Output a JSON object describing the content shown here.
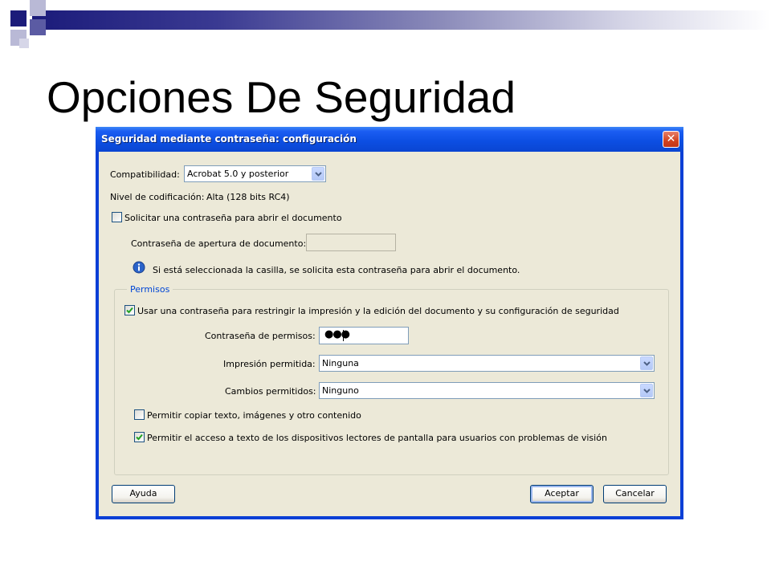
{
  "slide": {
    "title": "Opciones De Seguridad",
    "accent_color": "#1b1b7a"
  },
  "dialog": {
    "title": "Seguridad mediante contraseña: configuración",
    "close_icon": "close-icon",
    "compat": {
      "label": "Compatibilidad:",
      "value": "Acrobat 5.0 y posterior"
    },
    "encryption": {
      "label": "Nivel de codificación:",
      "value": "Alta (128 bits RC4)"
    },
    "open_password": {
      "checkbox_label": "Solicitar una contraseña para abrir el documento",
      "checked": false,
      "field_label": "Contraseña de apertura de documento:",
      "value": "",
      "info_icon": "info-icon",
      "info_text": "Si está seleccionada la casilla, se solicita esta contraseña para abrir el documento."
    },
    "permissions": {
      "legend": "Permisos",
      "restrict_label": "Usar una contraseña para restringir la impresión y la edición del documento y su configuración de seguridad",
      "restrict_checked": true,
      "password_label": "Contraseña de permisos:",
      "password_mask": "●●●",
      "printing_label": "Impresión permitida:",
      "printing_value": "Ninguna",
      "changes_label": "Cambios permitidos:",
      "changes_value": "Ninguno",
      "copy_label": "Permitir copiar texto, imágenes y otro contenido",
      "copy_checked": false,
      "screenreader_label": "Permitir el acceso a texto de los dispositivos lectores de pantalla para usuarios con problemas de visión",
      "screenreader_checked": true
    },
    "buttons": {
      "help": "Ayuda",
      "ok": "Aceptar",
      "cancel": "Cancelar"
    }
  }
}
